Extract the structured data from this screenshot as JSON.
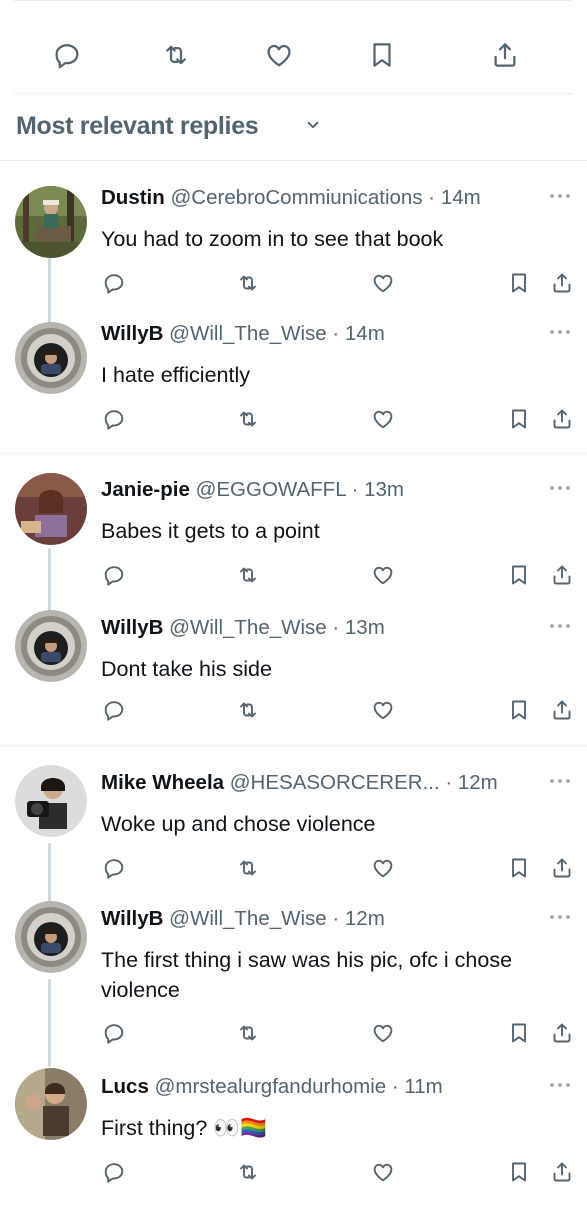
{
  "top_actions": {
    "icons": [
      "reply-icon",
      "retweet-icon",
      "like-icon",
      "bookmark-icon",
      "share-icon"
    ]
  },
  "replies_header": {
    "title": "Most relevant replies"
  },
  "replies": [
    {
      "name": "Dustin",
      "handle": "@CerebroCommiunications",
      "time": "14m",
      "text": "You had to zoom in to see that book"
    },
    {
      "name": "WillyB",
      "handle": "@Will_The_Wise",
      "time": "14m",
      "text": "I hate efficiently"
    },
    {
      "name": "Janie-pie",
      "handle": "@EGGOWAFFL",
      "time": "13m",
      "text": "Babes it gets to a point"
    },
    {
      "name": "WillyB",
      "handle": "@Will_The_Wise",
      "time": "13m",
      "text": "Dont take his side"
    },
    {
      "name": "Mike Wheela",
      "handle": "@HESASORCERER...",
      "time": "12m",
      "text": "Woke up and chose violence"
    },
    {
      "name": "WillyB",
      "handle": "@Will_The_Wise",
      "time": "12m",
      "text": "The first thing i saw was his pic, ofc i chose violence"
    },
    {
      "name": "Lucs",
      "handle": "@mrstealurgfandurhomie",
      "time": "11m",
      "text": "First thing? 👀🏳️‍🌈"
    }
  ],
  "dot_separator": "·"
}
